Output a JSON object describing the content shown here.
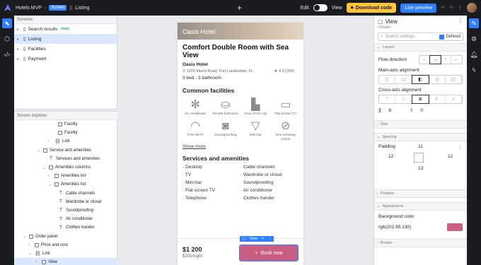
{
  "topbar": {
    "project_name": "Hotels MVP",
    "breadcrumb_pill": "Screen",
    "breadcrumb_current": "Listing",
    "edit_label": "Edit",
    "view_label": "View",
    "download_label": "Download code",
    "live_preview_label": "Live preview"
  },
  "left_rail": {
    "icons": [
      "cursor-icon",
      "components-icon",
      "code-icon"
    ]
  },
  "screens": {
    "heading": "Screens",
    "items": [
      {
        "label": "Search results",
        "tag": "main"
      },
      {
        "label": "Listing",
        "selected": true
      },
      {
        "label": "Facilities"
      },
      {
        "label": "Payment"
      }
    ]
  },
  "explorer": {
    "heading": "Screen explorer",
    "items": [
      {
        "label": "Facility"
      },
      {
        "label": "Facility"
      },
      {
        "label": "Link"
      },
      {
        "label": "Service and amenities"
      },
      {
        "label": "Services and amenities"
      },
      {
        "label": "Amenities columns"
      },
      {
        "label": "Amenities list"
      },
      {
        "label": "Amenities list"
      },
      {
        "label": "Cable channels"
      },
      {
        "label": "Wardrobe or closet"
      },
      {
        "label": "Soundproofing"
      },
      {
        "label": "Air conditioner"
      },
      {
        "label": "Clothes hander"
      },
      {
        "label": "Order panel"
      },
      {
        "label": "Price and cost"
      },
      {
        "label": "Link"
      },
      {
        "label": "View",
        "selected": true
      }
    ]
  },
  "page": {
    "hero_title": "Oasis Hotel",
    "title": "Comfort Double Room with Sea View",
    "hotel": "Oasis Hotel",
    "address": "1200 Miami Road, Fort Lauderdale, FL",
    "rating": "4.9 (200)",
    "meta": "3 bed · 3 bathroom",
    "facilities_heading": "Common facilities",
    "facilities": [
      {
        "label": "Air conditioner",
        "icon": "snowflake-icon",
        "glyph": "✻"
      },
      {
        "label": "Private bathroom",
        "icon": "bathtub-icon",
        "glyph": "⛀"
      },
      {
        "label": "View of the city",
        "icon": "city-icon",
        "glyph": "▙"
      },
      {
        "label": "Flat screen TV",
        "icon": "tv-icon",
        "glyph": "▭"
      },
      {
        "label": "Free Wi-Fi",
        "icon": "wifi-icon",
        "glyph": "◠"
      },
      {
        "label": "Soundproofing",
        "icon": "speaker-icon",
        "glyph": "◙"
      },
      {
        "label": "Mini-bar",
        "icon": "cocktail-icon",
        "glyph": "▽"
      },
      {
        "label": "Non-smoking rooms",
        "icon": "no-smoking-icon",
        "glyph": "⊘"
      }
    ],
    "show_more": "Show more",
    "services_heading": "Services and amenities",
    "services_left": [
      "Desktop",
      "TV",
      "Mini-bar",
      "Flat screen TV",
      "Telephone"
    ],
    "services_right": [
      "Cable channels",
      "Wardrobe or closet",
      "Soundproofing",
      "Air conditioner",
      "Clothes hander"
    ],
    "price": "$1 200",
    "price_note": "$200/night",
    "book_label": "Book now",
    "chip_label": "View"
  },
  "inspector": {
    "title": "View",
    "subtitle": "<Views>",
    "search_placeholder": "Search settings...",
    "defined_label": "Defined",
    "layout_section": "Layout",
    "flow_direction_label": "Flow direction",
    "main_axis_label": "Main-axis alignment",
    "cross_axis_label": "Cross-axis alignment",
    "gap_values": [
      "8",
      "0"
    ],
    "size_section": "Size",
    "spacing_section": "Spacing",
    "padding_label": "Padding",
    "padding": {
      "top": "11",
      "left": "12",
      "right": "12",
      "bottom": "13"
    },
    "position_section": "Position",
    "appearance_section": "Appearance",
    "bg_label": "Background color",
    "bg_value": "rgb(202 95 130)",
    "bg_hex": "#ca5f82",
    "border_section": "Border"
  }
}
